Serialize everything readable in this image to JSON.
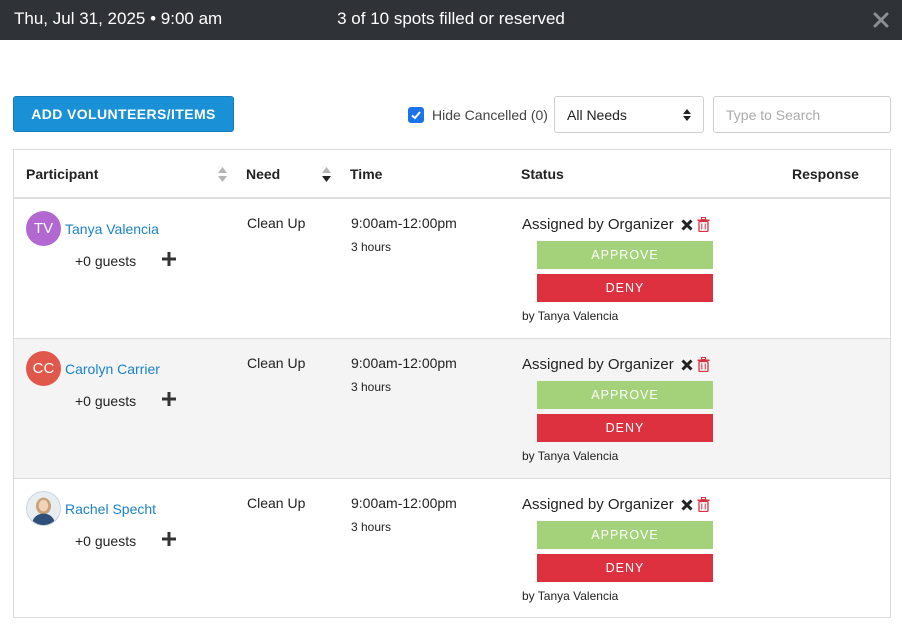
{
  "header": {
    "date": "Thu, Jul 31, 2025 • 9:00 am",
    "spots": "3 of 10 spots filled or reserved",
    "close_icon": "close-icon"
  },
  "toolbar": {
    "add_label": "ADD VOLUNTEERS/ITEMS",
    "hide_cancelled_label": "Hide Cancelled (0)",
    "hide_cancelled_checked": true,
    "needs_selected": "All Needs",
    "search_placeholder": "Type to Search"
  },
  "table": {
    "headers": {
      "participant": "Participant",
      "need": "Need",
      "time": "Time",
      "status": "Status",
      "response": "Response"
    },
    "rows": [
      {
        "initials": "TV",
        "avatar_color": "#b268d0",
        "name": "Tanya Valencia",
        "guests": "+0 guests",
        "need": "Clean Up",
        "time": "9:00am-12:00pm",
        "duration": "3 hours",
        "status": "Assigned by Organizer",
        "approve": "APPROVE",
        "deny": "DENY",
        "by": "by Tanya Valencia"
      },
      {
        "initials": "CC",
        "avatar_color": "#e0584c",
        "name": "Carolyn Carrier",
        "guests": "+0 guests",
        "need": "Clean Up",
        "time": "9:00am-12:00pm",
        "duration": "3 hours",
        "status": "Assigned by Organizer",
        "approve": "APPROVE",
        "deny": "DENY",
        "by": "by Tanya Valencia"
      },
      {
        "initials": "",
        "avatar_color": "#6c8fae",
        "name": "Rachel Specht",
        "guests": "+0 guests",
        "need": "Clean Up",
        "time": "9:00am-12:00pm",
        "duration": "3 hours",
        "status": "Assigned by Organizer",
        "approve": "APPROVE",
        "deny": "DENY",
        "by": "by Tanya Valencia"
      }
    ]
  },
  "colors": {
    "topbar": "#2f3337",
    "primary": "#1a90d6",
    "approve": "#a4d27b",
    "deny": "#de3140",
    "link": "#1a83c6"
  }
}
